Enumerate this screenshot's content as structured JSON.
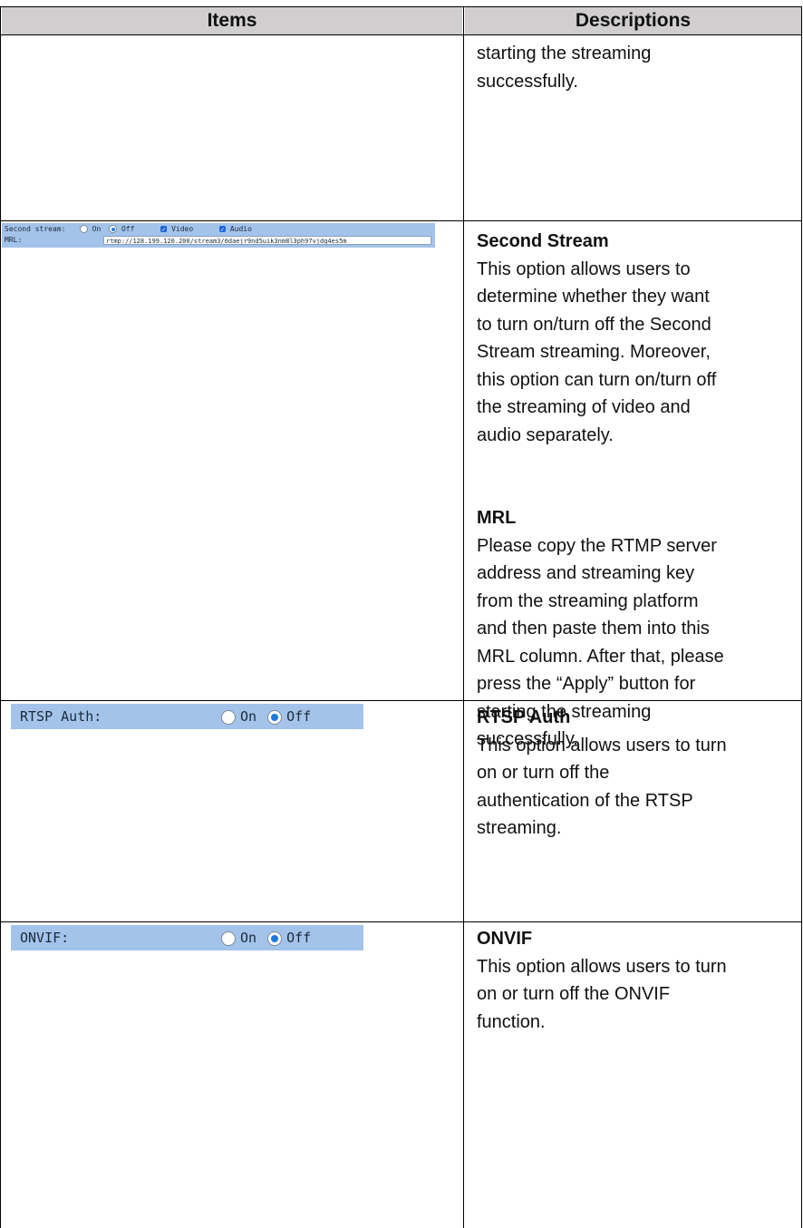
{
  "header": {
    "col1": "Items",
    "col2": "Descriptions"
  },
  "row0": {
    "lines": [
      "starting the streaming",
      "successfully."
    ]
  },
  "second_stream_ui": {
    "label": "Second stream:",
    "on": "On",
    "off": "Off",
    "selected": "Off",
    "video": "Video",
    "audio": "Audio",
    "mrl_label": "MRL:",
    "mrl_value": "rtmp://128.199.120.200/stream3/0daejr9nd5uik3nm8l3ph97vjdg4es5m"
  },
  "second_stream_desc": {
    "title": "Second Stream",
    "lines": [
      "This option allows users to",
      "determine whether they want",
      "to turn on/turn off the Second",
      "Stream streaming. Moreover,",
      "this option can turn on/turn off",
      "the streaming of video and",
      "audio separately."
    ],
    "mrl_title": "MRL",
    "mrl_lines": [
      "Please copy the RTMP server",
      "address and streaming key",
      "from the streaming platform",
      "and then paste them into this",
      "MRL column. After that, please",
      "press the “Apply” button for",
      "starting the streaming",
      "successfully."
    ]
  },
  "rtsp_ui": {
    "label": "RTSP Auth:",
    "on": "On",
    "off": "Off",
    "selected": "Off"
  },
  "rtsp_desc": {
    "title": "RTSP Auth",
    "lines": [
      "This option allows users to turn",
      "on or turn off the",
      "authentication of the RTSP",
      "streaming."
    ]
  },
  "onvif_ui": {
    "label": "ONVIF:",
    "on": "On",
    "off": "Off",
    "selected": "Off"
  },
  "onvif_desc": {
    "title": "ONVIF",
    "lines": [
      "This option allows users to turn",
      "on or turn off the ONVIF",
      "function."
    ]
  }
}
